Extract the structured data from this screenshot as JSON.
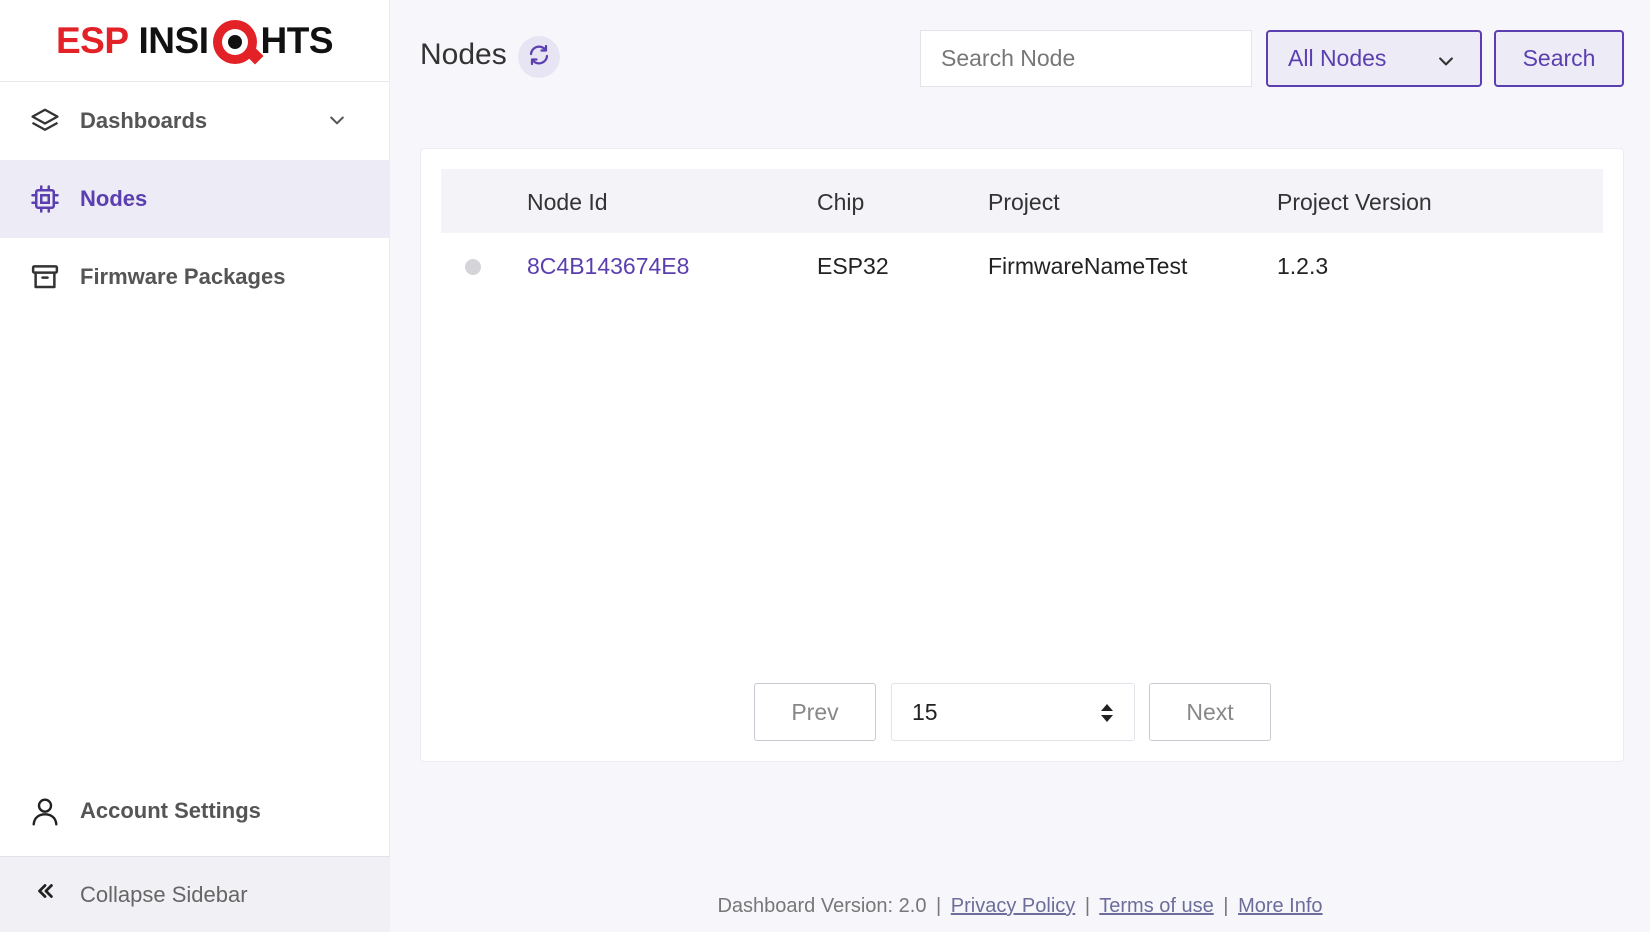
{
  "brand": {
    "logo_left": "ESP",
    "logo_mid": "INSI",
    "logo_right": "HTS",
    "logo_full": "ESP INSIGHTS"
  },
  "sidebar": {
    "items": [
      {
        "label": "Dashboards",
        "icon": "layers-icon",
        "active": false,
        "has_submenu": true
      },
      {
        "label": "Nodes",
        "icon": "chip-icon",
        "active": true
      },
      {
        "label": "Firmware Packages",
        "icon": "archive-icon",
        "active": false
      }
    ],
    "account": {
      "label": "Account Settings",
      "icon": "user-icon"
    },
    "collapse": {
      "label": "Collapse Sidebar",
      "icon": "double-chevron-left-icon"
    }
  },
  "header": {
    "title": "Nodes",
    "search_placeholder": "Search Node",
    "filter_value": "All Nodes",
    "search_label": "Search"
  },
  "table": {
    "columns": [
      "Node Id",
      "Chip",
      "Project",
      "Project Version"
    ],
    "rows": [
      {
        "status": "offline",
        "node_id": "8C4B143674E8",
        "chip": "ESP32",
        "project": "FirmwareNameTest",
        "version": "1.2.3"
      }
    ]
  },
  "pagination": {
    "prev_label": "Prev",
    "page_size": "15",
    "next_label": "Next"
  },
  "footer": {
    "version_text": "Dashboard Version: 2.0",
    "privacy": "Privacy Policy",
    "terms": "Terms of use",
    "more": "More Info",
    "separator": "|"
  },
  "colors": {
    "accent": "#5b3fb0",
    "brand_red": "#e32228",
    "active_bg": "#ecebf6"
  }
}
